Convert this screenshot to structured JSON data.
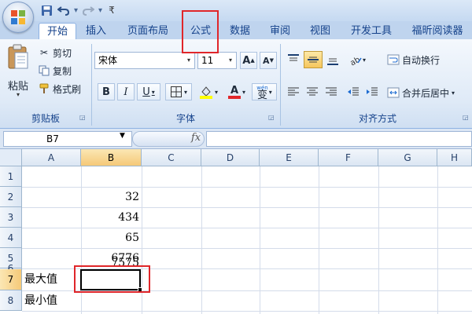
{
  "quick_access": {
    "icons": [
      "office-logo",
      "save-icon",
      "undo-icon",
      "redo-icon",
      "customize-icon"
    ],
    "customize_symbol": "₹"
  },
  "tabs": [
    {
      "label": "开始",
      "active": true
    },
    {
      "label": "插入",
      "active": false
    },
    {
      "label": "页面布局",
      "active": false
    },
    {
      "label": "公式",
      "active": false,
      "highlighted": true
    },
    {
      "label": "数据",
      "active": false
    },
    {
      "label": "审阅",
      "active": false
    },
    {
      "label": "视图",
      "active": false
    },
    {
      "label": "开发工具",
      "active": false
    },
    {
      "label": "福昕阅读器",
      "active": false
    }
  ],
  "ribbon": {
    "clipboard": {
      "label": "剪贴板",
      "paste": "粘贴",
      "cut": "剪切",
      "copy": "复制",
      "format_painter": "格式刷"
    },
    "font": {
      "label": "字体",
      "font_name": "宋体",
      "font_size": "11",
      "grow_font": "A",
      "shrink_font": "A",
      "bold": "B",
      "italic": "I",
      "underline": "U",
      "font_color_letter": "A",
      "phonetic": "wén",
      "phonetic_char": "变"
    },
    "alignment": {
      "label": "对齐方式",
      "wrap_text": "自动换行",
      "merge_center": "合并后居中"
    }
  },
  "formula_bar": {
    "name_box": "B7",
    "fx_label": "fx",
    "formula": ""
  },
  "sheet": {
    "columns": [
      "A",
      "B",
      "C",
      "D",
      "E",
      "F",
      "G",
      "H"
    ],
    "selected_column": "B",
    "rows": [
      "1",
      "2",
      "3",
      "4",
      "5",
      "6",
      "7",
      "8"
    ],
    "selected_row": "7",
    "cells": {
      "B2": "32",
      "B3": "434",
      "B4": "65",
      "B5": "6776",
      "B6": "7575",
      "A7": "最大值",
      "A8": "最小值"
    },
    "active_cell": "B7"
  },
  "colors": {
    "highlight_red": "#e0262a",
    "tab_text": "#15428b",
    "ribbon_bg": "#dfeaf7",
    "header_selected": "#f5c978"
  }
}
